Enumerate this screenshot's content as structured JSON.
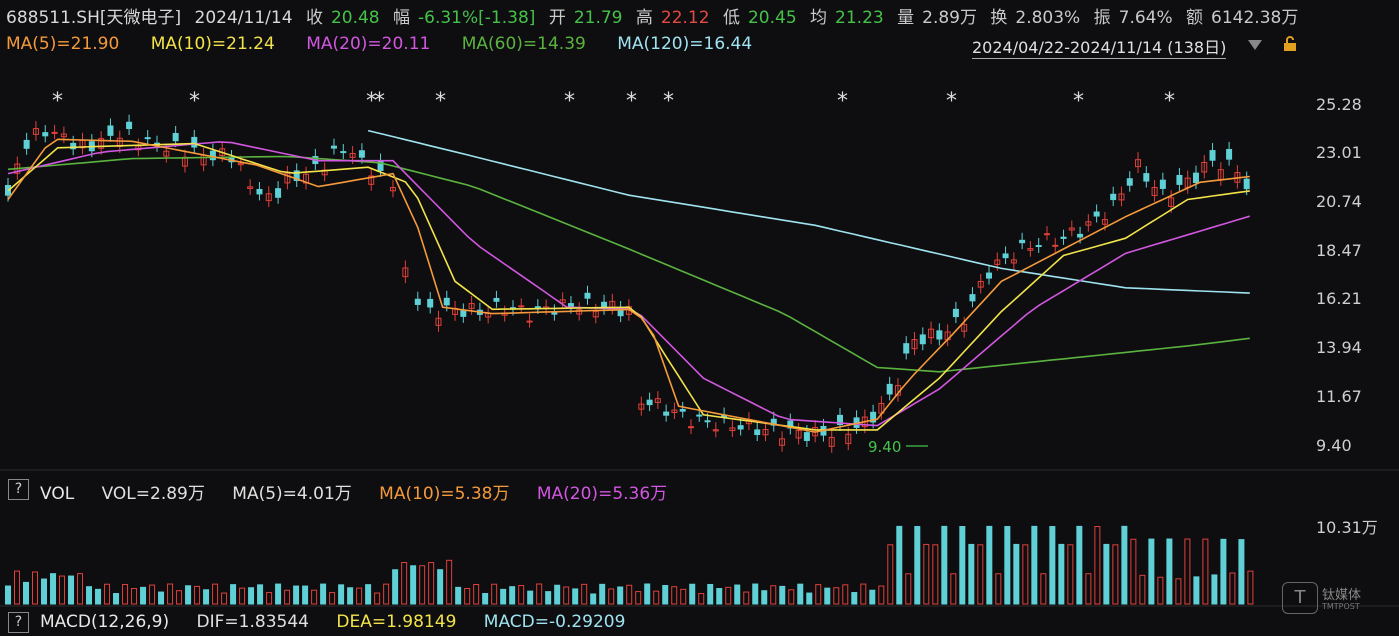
{
  "header": {
    "code": "688511.SH[天微电子]",
    "date": "2024/11/14",
    "close_label": "收",
    "close_value": "20.48",
    "change_label": "幅",
    "change_value": "-6.31%[-1.38]",
    "open_label": "开",
    "open_value": "21.79",
    "high_label": "高",
    "high_value": "22.12",
    "low_label": "低",
    "low_value": "20.45",
    "avg_label": "均",
    "avg_value": "21.23",
    "vol_label": "量",
    "vol_value": "2.89万",
    "turnover_label": "换",
    "turnover_value": "2.803%",
    "amplitude_label": "振",
    "amplitude_value": "7.64%",
    "amount_label": "额",
    "amount_value": "6142.38万"
  },
  "ma_legend": {
    "ma5": "MA(5)=21.90",
    "ma10": "MA(10)=21.24",
    "ma20": "MA(20)=20.11",
    "ma60": "MA(60)=14.39",
    "ma120": "MA(120)=16.44"
  },
  "range_label": "2024/04/22-2024/11/14 (138日)",
  "price_axis": [
    "25.28",
    "23.01",
    "20.74",
    "18.47",
    "16.21",
    "13.94",
    "11.67",
    "9.40"
  ],
  "low_marker": "9.40",
  "vol_panel": {
    "help": "?",
    "title": "VOL",
    "vol": "VOL=2.89万",
    "ma5": "MA(5)=4.01万",
    "ma10": "MA(10)=5.38万",
    "ma20": "MA(20)=5.36万",
    "axis_max": "10.31万"
  },
  "macd_panel": {
    "help": "?",
    "title": "MACD(12,26,9)",
    "dif": "DIF=1.83544",
    "dea": "DEA=1.98149",
    "macd": "MACD=-0.29209"
  },
  "watermark": {
    "name": "钛媒体",
    "sub": "TMTPOST"
  },
  "colors": {
    "up": "#e0403a",
    "down": "#5fd0d6",
    "ma5": "#f59a3b",
    "ma10": "#f2e34a",
    "ma20": "#d257e0",
    "ma60": "#5bb33f",
    "ma120": "#9fe3f0",
    "green_text": "#45c24a",
    "red_text": "#e24a42"
  }
}
